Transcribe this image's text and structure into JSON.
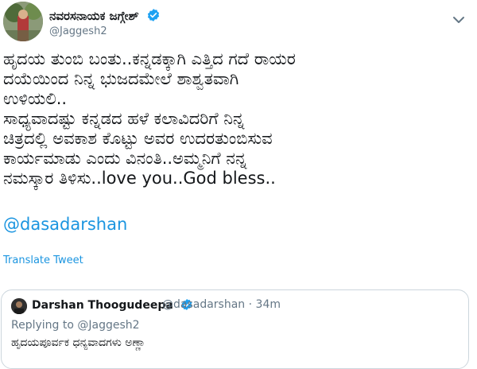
{
  "tweet": {
    "author": {
      "display_name": "ನವರಸನಾಯಕ ಜಗ್ಗೇಶ್",
      "handle": "@Jaggesh2",
      "verified_icon": "verified-badge-icon"
    },
    "menu_icon": "chevron-down-icon",
    "text_lines": [
      "ಹೃದಯ ತುಂಬಿ ಬಂತು..ಕನ್ನಡಕ್ಕಾಗಿ ಎತ್ತಿದ ಗದೆ ರಾಯರ",
      "ದಯೆಯಿಂದ ನಿನ್ನ ಭುಜದಮೇಲೆ ಶಾಶ್ವತವಾಗಿ",
      "ಉಳಿಯಲಿ..",
      "ಸಾಧ್ಯವಾದಷ್ಟು ಕನ್ನಡದ ಹಳೆ ಕಲಾವಿದರಿಗೆ ನಿನ್ನ",
      "ಚಿತ್ರದಲ್ಲಿ ಅವಕಾಶ ಕೊಟ್ಟು ಅವರ ಉದರತುಂಬಿಸುವ",
      "ಕಾರ್ಯಮಾಡು ಎಂದು ವಿನಂತಿ..ಅಮ್ಮನಿಗೆ ನನ್ನ",
      "ನಮಸ್ಕಾರ ತಿಳಿಸು..love you..God bless.."
    ],
    "mention": "@dasadarshan",
    "translate_label": "Translate Tweet"
  },
  "quoted_tweet": {
    "display_name": "Darshan Thoogudeepa",
    "handle": "@dasadarshan",
    "separator": "·",
    "time": "34m",
    "replying_to": "Replying to @Jaggesh2",
    "text": "ಹೃದಯಪೂರ್ವಕ ಧನ್ಯವಾದಗಳು ಅಣ್ಣಾ"
  },
  "colors": {
    "link": "#1b95e0",
    "secondary_text": "#657786",
    "border": "#ccd6dd"
  }
}
